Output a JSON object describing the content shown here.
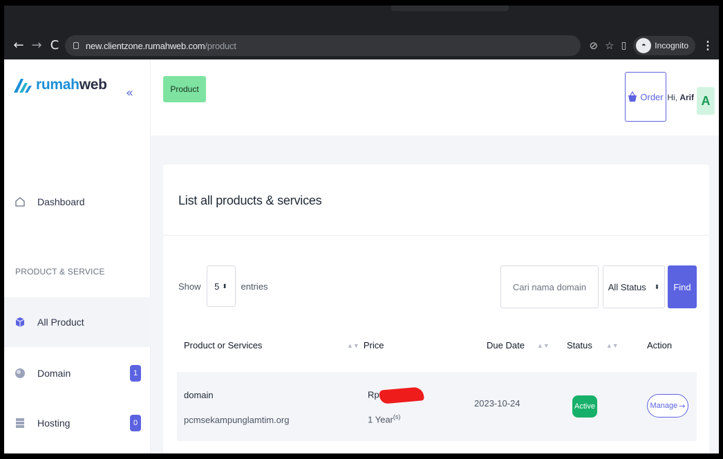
{
  "browser": {
    "url_host": "new.clientzone.rumahweb.com",
    "url_path": "/product",
    "incognito_label": "Incognito"
  },
  "sidebar": {
    "logo_a": "rumah",
    "logo_b": "web",
    "collapse_glyph": "«",
    "dashboard_label": "Dashboard",
    "section_label": "PRODUCT & SERVICE",
    "items": [
      {
        "label": "All Product",
        "icon": "box-icon",
        "active": true
      },
      {
        "label": "Domain",
        "icon": "globe-icon",
        "count": "1"
      },
      {
        "label": "Hosting",
        "icon": "server-icon",
        "count": "0"
      }
    ]
  },
  "topbar": {
    "page_tag": "Product",
    "order_label": "Order",
    "greeting_prefix": "Hi,",
    "user_name": "Arif",
    "avatar_letter": "A"
  },
  "card": {
    "title": "List all products & services",
    "show_label": "Show",
    "entries_value": "5",
    "entries_label": "entries",
    "search_placeholder": "Cari nama domain",
    "status_filter": "All Status",
    "find_label": "Find",
    "columns": [
      "Product or Services",
      "Price",
      "Due Date",
      "Status",
      "Action"
    ],
    "rows": [
      {
        "type": "domain",
        "name": "pcmsekampunglamtim.org",
        "price_prefix": "Rp",
        "period": "1 Year",
        "period_suffix": "(s)",
        "due_date": "2023-10-24",
        "status": "Active",
        "action": "Manage"
      }
    ]
  },
  "colors": {
    "accent": "#5b63e0",
    "product_tag": "#7ee3a1",
    "active_status": "#17b06a",
    "redaction": "#ef1c1c"
  }
}
